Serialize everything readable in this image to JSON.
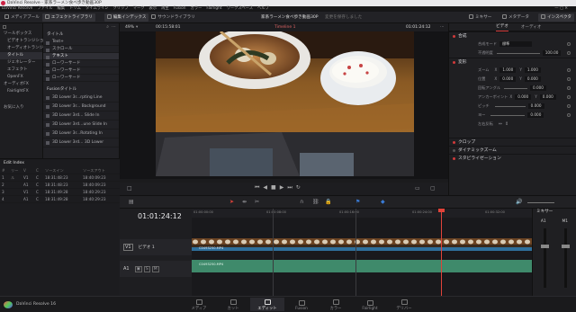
{
  "titlebar": {
    "title": "DaVinci Resolve - 家系ラーメン食べ歩き動画30P"
  },
  "menubar": {
    "items": [
      "DaVinci Resolve",
      "ファイル",
      "編集",
      "トリム",
      "タイムライン",
      "クリップ",
      "マーク",
      "表示",
      "再生",
      "Fusion",
      "カラー",
      "Fairlight",
      "ワークスペース",
      "ヘルプ"
    ]
  },
  "toolbar": {
    "media_pool": "メディアプール",
    "effects": "エフェクトライブラリ",
    "edit_index": "編集インデックス",
    "sound_library": "サウンドライブラリ",
    "project_title": "家系ラーメン食べ歩き動画30P",
    "project_status": "変更を保存しました",
    "mixer": "ミキサー",
    "metadata": "メタデータ",
    "inspector": "インスペクタ"
  },
  "effects_tree": {
    "items": [
      "ツールボックス",
      "ビデオトランジション",
      "オーディオトランジション",
      "タイトル",
      "ジェネレーター",
      "エフェクト",
      "OpenFX",
      "オーディオFX",
      "FairlightFX"
    ],
    "selected": 3,
    "favorites": "お気に入り"
  },
  "titles_panel": {
    "header": "タイトル",
    "items": [
      "Text+",
      "スクロール",
      "テキスト",
      "ローワーサード",
      "ローワーサード",
      "ローワーサード"
    ],
    "selected": 2,
    "fusion_header": "Fusionタイトル",
    "fusion_items": [
      "3D Lower 3r...rpting Line",
      "3D Lower 3r... Background",
      "3D Lower 3rd... Slide In",
      "3D Lower 3rd...une Slide In",
      "3D Lower 3r...Rotating In",
      "3D Lower 3rd... 3D Lower"
    ]
  },
  "viewer": {
    "zoom": "49%",
    "source_tc": "00:15:58:01",
    "timeline_name": "Timeline 1",
    "record_tc": "01:01:24:12"
  },
  "inspector": {
    "tab_video": "ビデオ",
    "tab_audio": "オーディオ",
    "sections": {
      "composite": "合成",
      "transform": "変形",
      "cropping": "クロップ",
      "dynamic_zoom": "ダイナミックズーム",
      "stabilization": "スタビライゼーション"
    },
    "composite_mode_label": "合成モード",
    "composite_mode_value": "標準",
    "opacity_label": "不透明度",
    "opacity_value": "100.00",
    "zoom_label": "ズーム",
    "zoom_x": "1.000",
    "zoom_y": "1.000",
    "position_label": "位置",
    "position_x": "0.000",
    "position_y": "0.000",
    "rotation_label": "回転アングル",
    "rotation_value": "0.000",
    "anchor_label": "アンカーポイント",
    "anchor_x": "0.000",
    "anchor_y": "0.000",
    "pitch_label": "ピッチ",
    "pitch_value": "0.000",
    "yaw_label": "ヨー",
    "yaw_value": "0.000",
    "flip_label": "左右反転"
  },
  "edit_index": {
    "title": "Edit Index",
    "columns": [
      "#",
      "リール",
      "V",
      "C",
      "ソースイン",
      "ソースアウト"
    ],
    "rows": [
      [
        "1",
        "",
        "V1",
        "C",
        "18:31:48:23",
        "18:40:09:23"
      ],
      [
        "2",
        "",
        "A1",
        "C",
        "18:31:48:23",
        "18:40:09:23"
      ],
      [
        "3",
        "",
        "V1",
        "C",
        "18:31:49:28",
        "18:40:29:23"
      ],
      [
        "4",
        "",
        "A1",
        "C",
        "18:31:49:28",
        "18:40:29:23"
      ]
    ]
  },
  "timeline": {
    "timecode": "01:01:24:12",
    "ruler": [
      "01:00:00:00",
      "01:00:08:00",
      "01:00:16:00",
      "01:00:24:00",
      "01:00:32:00",
      "01:00:40:00"
    ],
    "video_track": "V1",
    "video_track_name": "ビデオ 1",
    "audio_track": "A1",
    "clip_name": "C0493250.MP4",
    "audio_clip_name": "C0493250.MP4"
  },
  "mixer": {
    "title": "ミキサー",
    "channels": [
      "A1",
      "M1"
    ]
  },
  "bottombar": {
    "app": "DaVinci Resolve 16",
    "pages": [
      "メディア",
      "カット",
      "エディット",
      "Fusion",
      "カラー",
      "Fairlight",
      "デリバー"
    ],
    "active_page": 2
  },
  "colors": {
    "accent": "#d23a3a",
    "video_clip": "#2f6f9b",
    "audio_clip": "#3f8a6b",
    "playhead": "#e0433a"
  }
}
